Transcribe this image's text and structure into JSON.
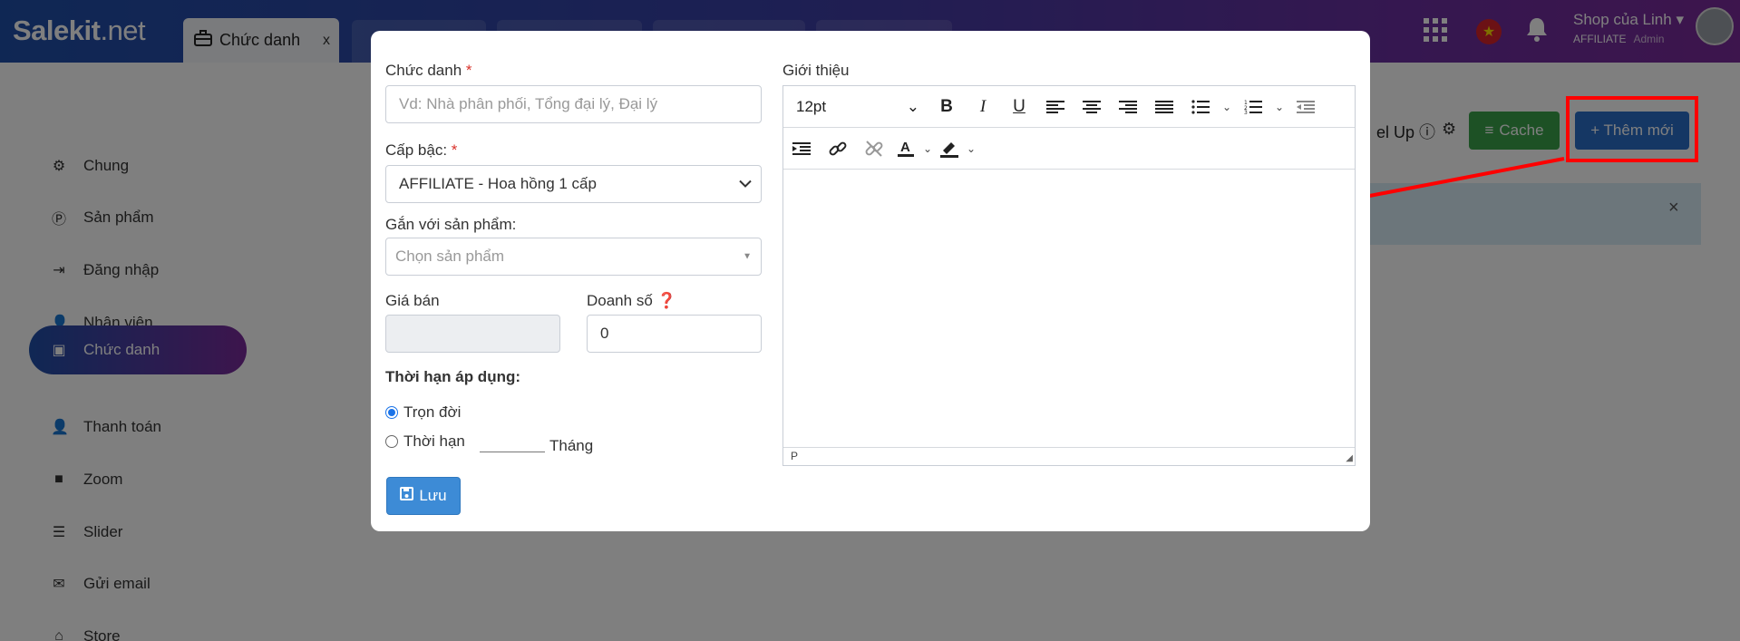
{
  "header": {
    "logo_main": "Salekit",
    "logo_suffix": ".net",
    "active_tab": "Chức danh",
    "close_tab": "x",
    "shop_name": "Shop của Linh",
    "shop_level": "AFFILIATE",
    "shop_role": "Admin"
  },
  "sidebar": {
    "items": [
      {
        "label": "Chung",
        "icon": "gear-icon"
      },
      {
        "label": "Sản phẩm",
        "icon": "product-icon"
      },
      {
        "label": "Đăng nhập",
        "icon": "login-icon"
      },
      {
        "label": "Nhân viên",
        "icon": "user-icon"
      },
      {
        "label": "Chức danh",
        "icon": "briefcase-icon"
      },
      {
        "label": "Thanh toán",
        "icon": "user-icon"
      },
      {
        "label": "Zoom",
        "icon": "video-icon"
      },
      {
        "label": "Slider",
        "icon": "sliders-icon"
      },
      {
        "label": "Gửi email",
        "icon": "mail-icon"
      },
      {
        "label": "Store",
        "icon": "store-icon"
      }
    ]
  },
  "main": {
    "level_up": "el Up",
    "cache_label": "Cache",
    "add_label": "+ Thêm mới",
    "alert_close": "×"
  },
  "modal": {
    "title_label": "Chức danh",
    "required_mark": "*",
    "title_placeholder": "Vd: Nhà phân phối, Tổng đại lý, Đại lý",
    "level_label": "Cấp bậc:",
    "level_value": "AFFILIATE - Hoa hồng 1 cấp",
    "product_label": "Gắn với sản phẩm:",
    "product_placeholder": "Chọn sản phẩm",
    "price_label": "Giá bán",
    "sales_label": "Doanh số",
    "sales_value": "0",
    "duration_label": "Thời hạn áp dụng:",
    "option_lifetime": "Trọn đời",
    "option_term": "Thời hạn",
    "month_label": "Tháng",
    "save_label": "Lưu",
    "intro_label": "Giới thiệu",
    "font_size": "12pt",
    "status_path": "P"
  },
  "colors": {
    "header_start": "#1f4fa8",
    "header_end": "#7a2a9a",
    "cache_btn": "#3aa24a",
    "add_btn": "#2a6fc9",
    "save_btn": "#3d8bd6",
    "annotation": "#ff0000"
  }
}
